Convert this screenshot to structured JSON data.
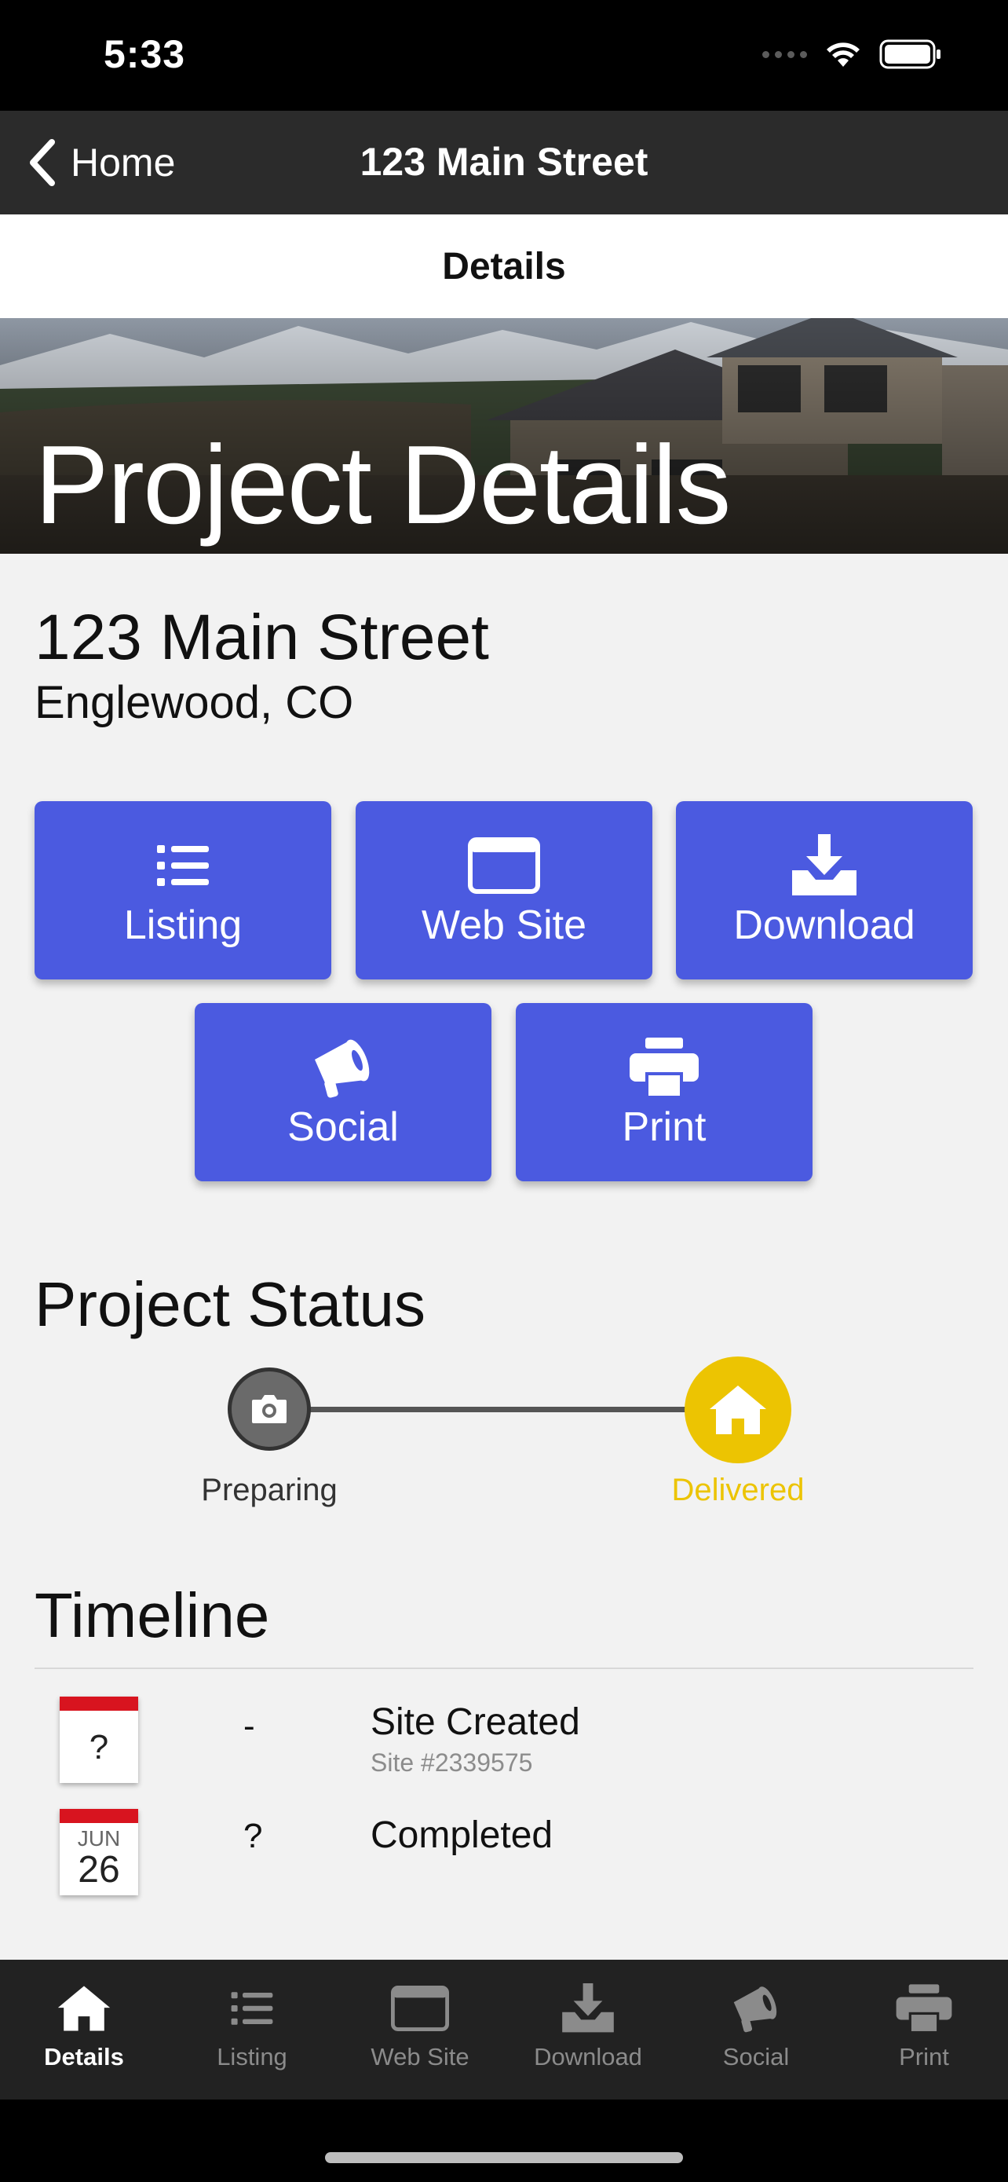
{
  "status_bar": {
    "time": "5:33"
  },
  "nav": {
    "back_label": "Home",
    "title": "123 Main Street"
  },
  "segment": {
    "label": "Details"
  },
  "hero": {
    "title": "Project Details"
  },
  "property": {
    "address": "123 Main Street",
    "city": "Englewood, CO"
  },
  "actions": [
    {
      "label": "Listing",
      "icon": "list-icon"
    },
    {
      "label": "Web Site",
      "icon": "browser-window-icon"
    },
    {
      "label": "Download",
      "icon": "download-icon"
    },
    {
      "label": "Social",
      "icon": "megaphone-icon"
    },
    {
      "label": "Print",
      "icon": "printer-icon"
    }
  ],
  "status": {
    "title": "Project Status",
    "steps": [
      {
        "label": "Preparing",
        "icon": "camera-icon",
        "color": "#6a6a6a"
      },
      {
        "label": "Delivered",
        "icon": "home-icon",
        "color": "#ecc402"
      }
    ]
  },
  "timeline": {
    "title": "Timeline",
    "items": [
      {
        "cal_text": "?",
        "cal_month": "",
        "cal_day": "",
        "middle": "-",
        "title": "Site Created",
        "subtitle": "Site #2339575"
      },
      {
        "cal_text": "",
        "cal_month": "JUN",
        "cal_day": "26",
        "middle": "?",
        "title": "Completed",
        "subtitle": ""
      }
    ]
  },
  "tabs": [
    {
      "label": "Details",
      "icon": "home-icon",
      "active": true
    },
    {
      "label": "Listing",
      "icon": "list-icon",
      "active": false
    },
    {
      "label": "Web Site",
      "icon": "browser-window-icon",
      "active": false
    },
    {
      "label": "Download",
      "icon": "download-icon",
      "active": false
    },
    {
      "label": "Social",
      "icon": "megaphone-icon",
      "active": false
    },
    {
      "label": "Print",
      "icon": "printer-icon",
      "active": false
    }
  ],
  "colors": {
    "accent": "#4b5ae0",
    "delivered": "#ecc402",
    "nav_bg": "#2b2b2b",
    "tab_bg": "#222222"
  }
}
